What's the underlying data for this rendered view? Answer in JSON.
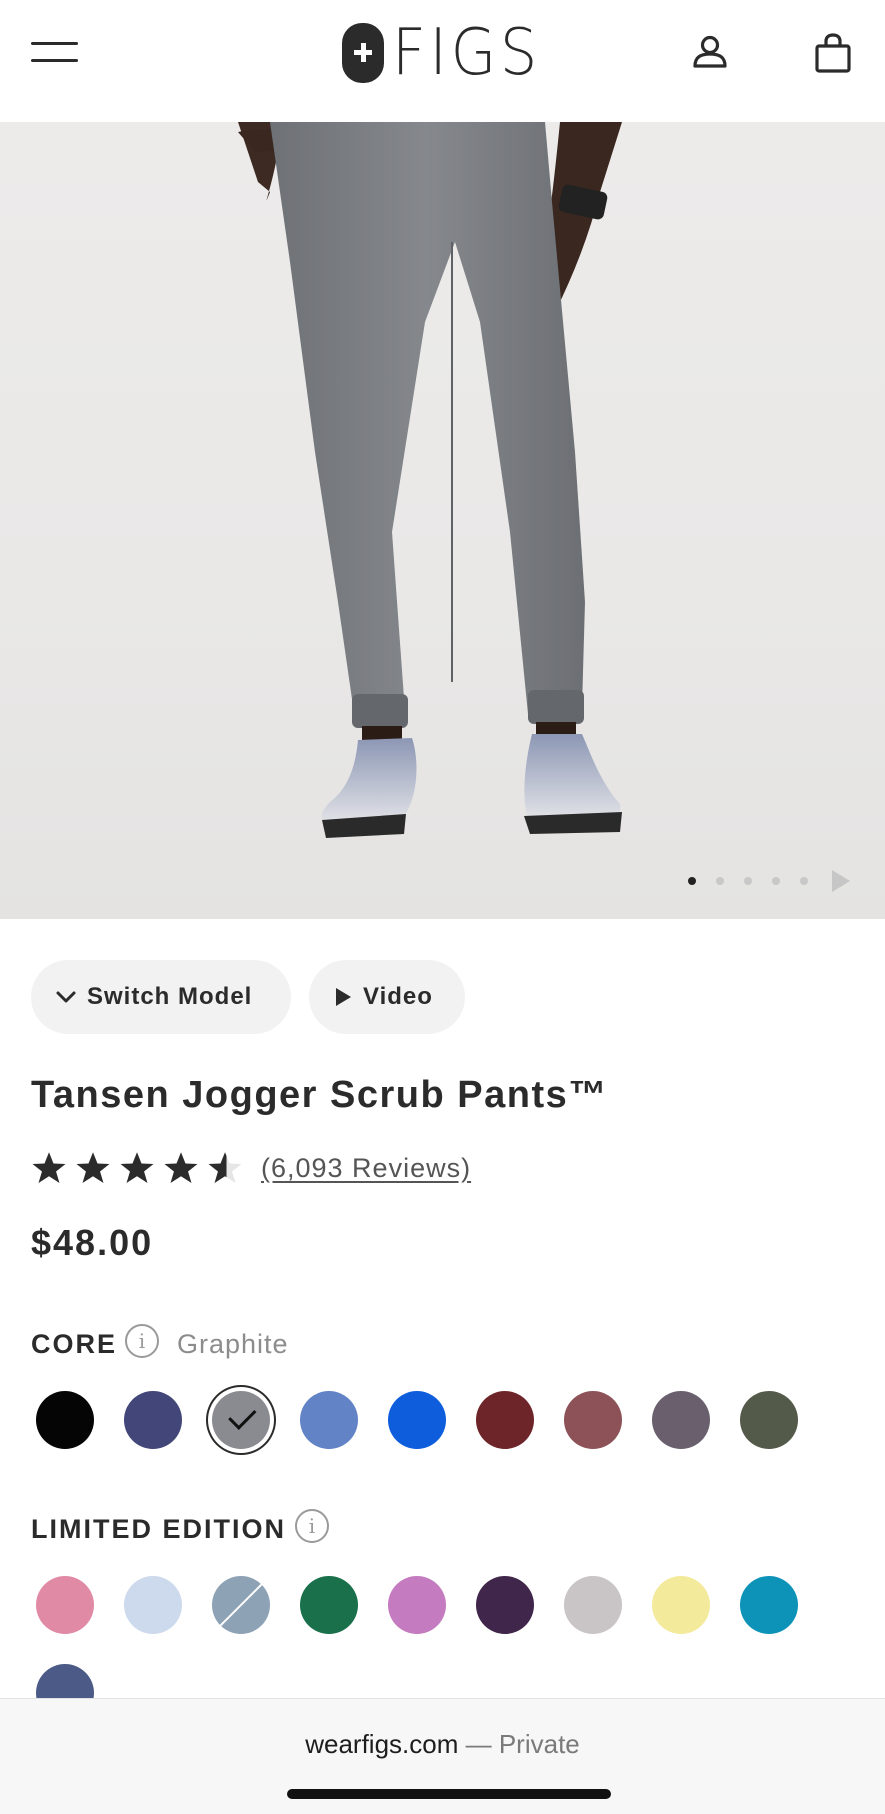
{
  "header": {
    "brand": "FIGS",
    "menu_icon": "hamburger-menu-icon",
    "account_icon": "account-icon",
    "bag_icon": "shopping-bag-icon"
  },
  "hero": {
    "image_description": "model-wearing-graphite-jogger-scrub-pants",
    "carousel": {
      "total": 5,
      "active_index": 1
    }
  },
  "actions": {
    "switch_model": "Switch Model",
    "video": "Video"
  },
  "product": {
    "name": "Tansen Jogger Scrub Pants™",
    "rating": 4.5,
    "reviews_label": "(6,093 Reviews)",
    "price": "$48.00"
  },
  "colors": {
    "core": {
      "label": "CORE",
      "selected_name": "Graphite",
      "swatches": [
        {
          "name": "Black",
          "hex": "#050505"
        },
        {
          "name": "Navy",
          "hex": "#434678"
        },
        {
          "name": "Graphite",
          "hex": "#8a8b91",
          "selected": true
        },
        {
          "name": "Ceil Blue",
          "hex": "#6383c7"
        },
        {
          "name": "Royal Blue",
          "hex": "#0e5ddc"
        },
        {
          "name": "Burgundy",
          "hex": "#6e2529"
        },
        {
          "name": "Mauve",
          "hex": "#8c5258"
        },
        {
          "name": "Charcoal",
          "hex": "#6a5f6c"
        },
        {
          "name": "Olive",
          "hex": "#545a4a"
        }
      ]
    },
    "limited": {
      "label": "LIMITED EDITION",
      "swatches": [
        {
          "name": "Pink",
          "hex": "#e08aa6"
        },
        {
          "name": "Light Blue",
          "hex": "#cdd9ec"
        },
        {
          "name": "Slate",
          "hex": "#8ea2b6",
          "soldout": true
        },
        {
          "name": "Green",
          "hex": "#19704a"
        },
        {
          "name": "Orchid",
          "hex": "#c57bc0"
        },
        {
          "name": "Plum",
          "hex": "#41264b"
        },
        {
          "name": "Silver",
          "hex": "#c9c4c5"
        },
        {
          "name": "Yellow",
          "hex": "#f4ea9c"
        },
        {
          "name": "Teal",
          "hex": "#0d93b8"
        },
        {
          "name": "Denim",
          "hex": "#4b5a86"
        }
      ]
    }
  },
  "browser": {
    "domain": "wearfigs.com",
    "mode": "— Private"
  }
}
